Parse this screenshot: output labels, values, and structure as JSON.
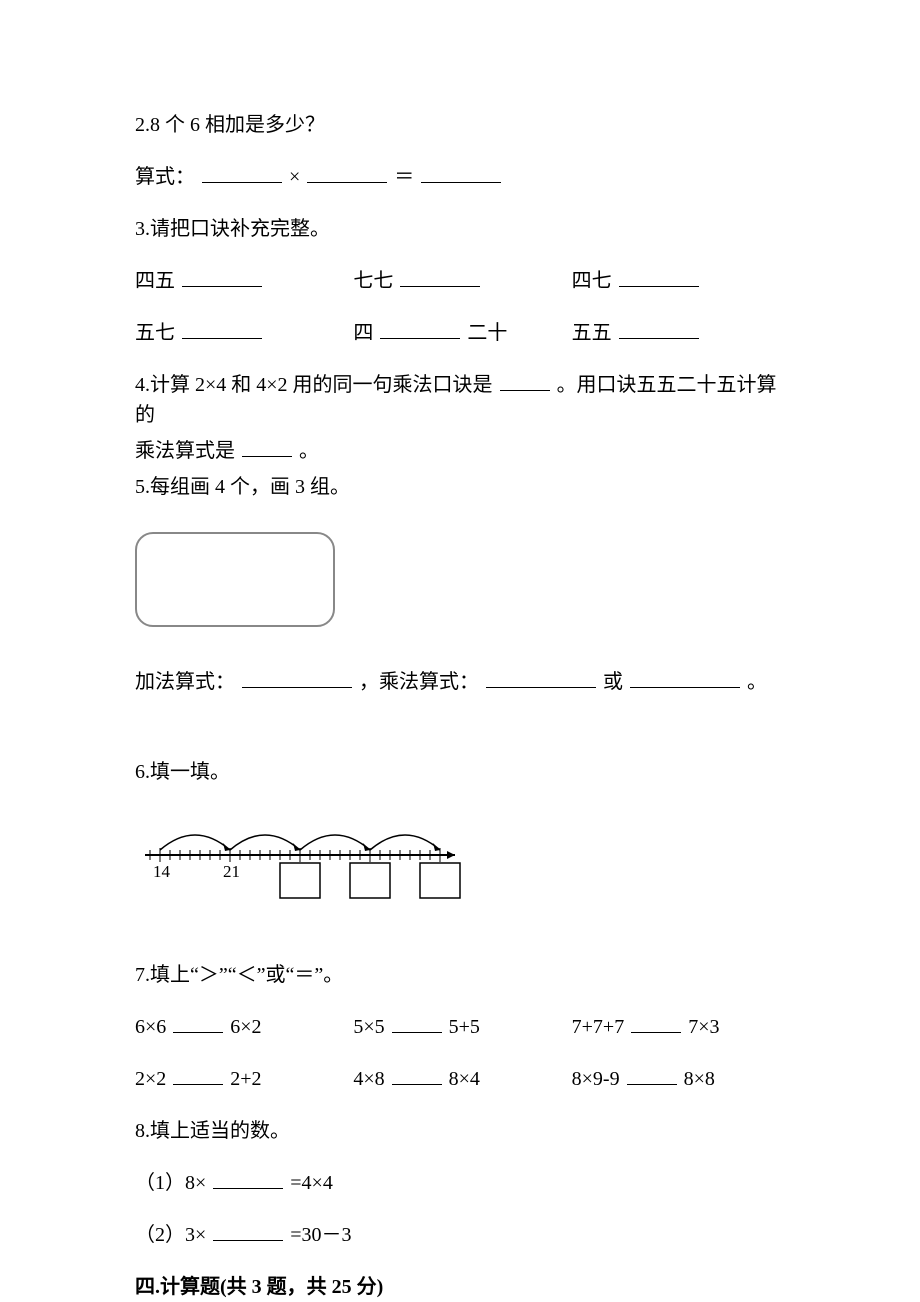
{
  "q2": {
    "prompt": "2.8 个 6 相加是多少？",
    "label": "算式：",
    "times": "×",
    "eq": "＝"
  },
  "q3": {
    "prompt": "3.请把口诀补充完整。",
    "r1c1": "四五",
    "r1c2": "七七",
    "r1c3": "四七",
    "r2c1": "五七",
    "r2c2a": "四",
    "r2c2b": "二十",
    "r2c3": "五五"
  },
  "q4": {
    "part1": "4.计算 2×4 和 4×2 用的同一句乘法口诀是",
    "part2": "。用口诀五五二十五计算的",
    "part3": "乘法算式是",
    "part4": "。"
  },
  "q5": {
    "prompt": "5.每组画 4 个，画 3 组。",
    "bottom_a": "加法算式：",
    "bottom_b": "，乘法算式：",
    "bottom_c": "或",
    "bottom_d": "。"
  },
  "q6": {
    "prompt": "6.填一填。",
    "tick1": "14",
    "tick2": "21"
  },
  "q7": {
    "prompt": "7.填上“＞”“＜”或“＝”。",
    "r1c1a": "6×6",
    "r1c1b": "6×2",
    "r1c2a": "5×5",
    "r1c2b": "5+5",
    "r1c3a": "7+7+7",
    "r1c3b": "7×3",
    "r2c1a": "2×2",
    "r2c1b": "2+2",
    "r2c2a": "4×8",
    "r2c2b": "8×4",
    "r2c3a": "8×9-9",
    "r2c3b": "8×8"
  },
  "q8": {
    "prompt": "8.填上适当的数。",
    "item1a": "（1）8×",
    "item1b": "=4×4",
    "item2a": "（2）3×",
    "item2b": "=30－3"
  },
  "section4": {
    "heading": "四.计算题(共 3 题，共 25 分)"
  }
}
